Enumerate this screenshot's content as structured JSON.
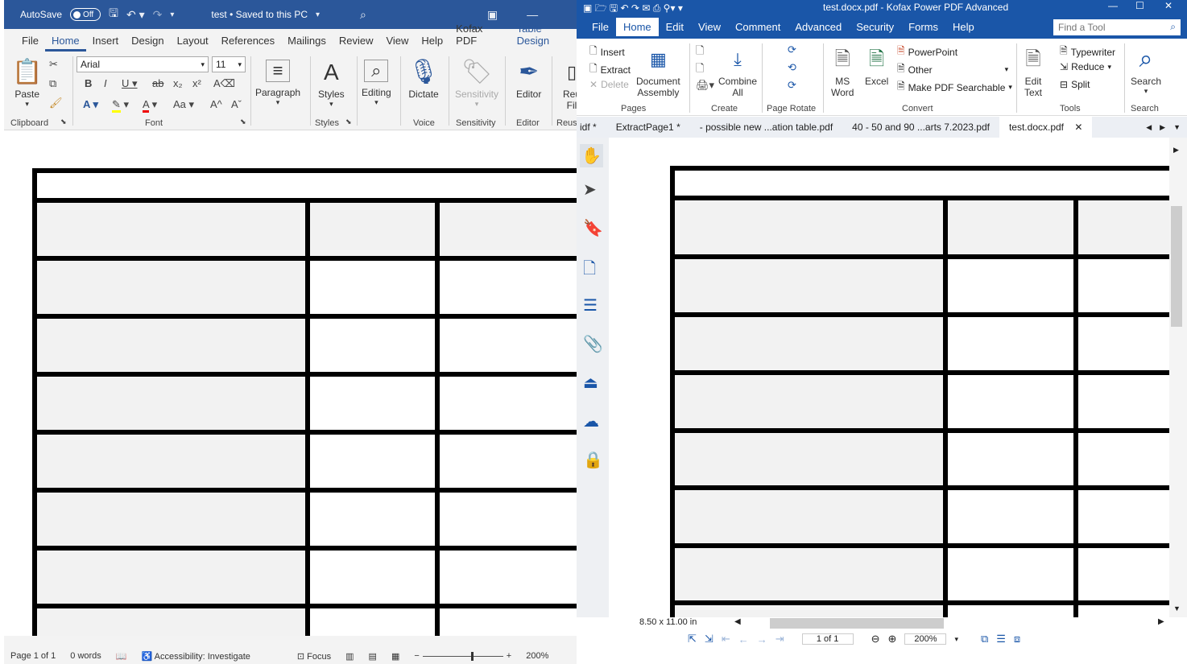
{
  "word": {
    "autosave_label": "AutoSave",
    "autosave_state": "Off",
    "doc_title": "test • Saved to this PC",
    "tabs": [
      "File",
      "Home",
      "Insert",
      "Design",
      "Layout",
      "References",
      "Mailings",
      "Review",
      "View",
      "Help",
      "Kofax PDF",
      "Table Design"
    ],
    "active_tab": "Home",
    "ribbon": {
      "paste_label": "Paste",
      "font_name": "Arial",
      "font_size": "11",
      "paragraph_label": "Paragraph",
      "styles_label": "Styles",
      "editing_label": "Editing",
      "dictate_label": "Dictate",
      "sensitivity_label": "Sensitivity",
      "editor_label": "Editor",
      "reuse_label": "Reu",
      "reuse_label2": "Fil",
      "groups": [
        "Clipboard",
        "Font",
        "Styles",
        "Voice",
        "Sensitivity",
        "Editor",
        "Reuse"
      ]
    },
    "status": {
      "page": "Page 1 of 1",
      "words": "0 words",
      "accessibility": "Accessibility: Investigate",
      "focus": "Focus",
      "zoom": "200%"
    }
  },
  "pdf": {
    "title": "test.docx.pdf - Kofax Power PDF Advanced",
    "menu_tabs": [
      "File",
      "Home",
      "Edit",
      "View",
      "Comment",
      "Advanced",
      "Security",
      "Forms",
      "Help"
    ],
    "active_tab": "Home",
    "find_placeholder": "Find a Tool",
    "ribbon": {
      "insert": "Insert",
      "extract": "Extract",
      "delete": "Delete",
      "doc_assembly_1": "Document",
      "doc_assembly_2": "Assembly",
      "combine_1": "Combine",
      "combine_2": "All",
      "ms_word_1": "MS",
      "ms_word_2": "Word",
      "excel": "Excel",
      "powerpoint": "PowerPoint",
      "other": "Other",
      "searchable": "Make PDF Searchable",
      "edit_text_1": "Edit",
      "edit_text_2": "Text",
      "typewriter": "Typewriter",
      "reduce": "Reduce",
      "split": "Split",
      "search": "Search",
      "groups": [
        "Pages",
        "Create",
        "Page Rotate",
        "Convert",
        "Tools",
        "Search"
      ]
    },
    "doc_tabs": [
      "idf *",
      "ExtractPage1 *",
      "- possible new ...ation table.pdf",
      "40 - 50 and 90 ...arts 7.2023.pdf",
      "test.docx.pdf"
    ],
    "active_doc_tab": "test.docx.pdf",
    "page_size": "8.50 x 11.00 in",
    "page_indicator": "1 of 1",
    "zoom": "200%"
  },
  "colors": {
    "word_blue": "#2b579a",
    "pdf_blue": "#1a56a8",
    "table_shading": "#f2f2f2"
  }
}
